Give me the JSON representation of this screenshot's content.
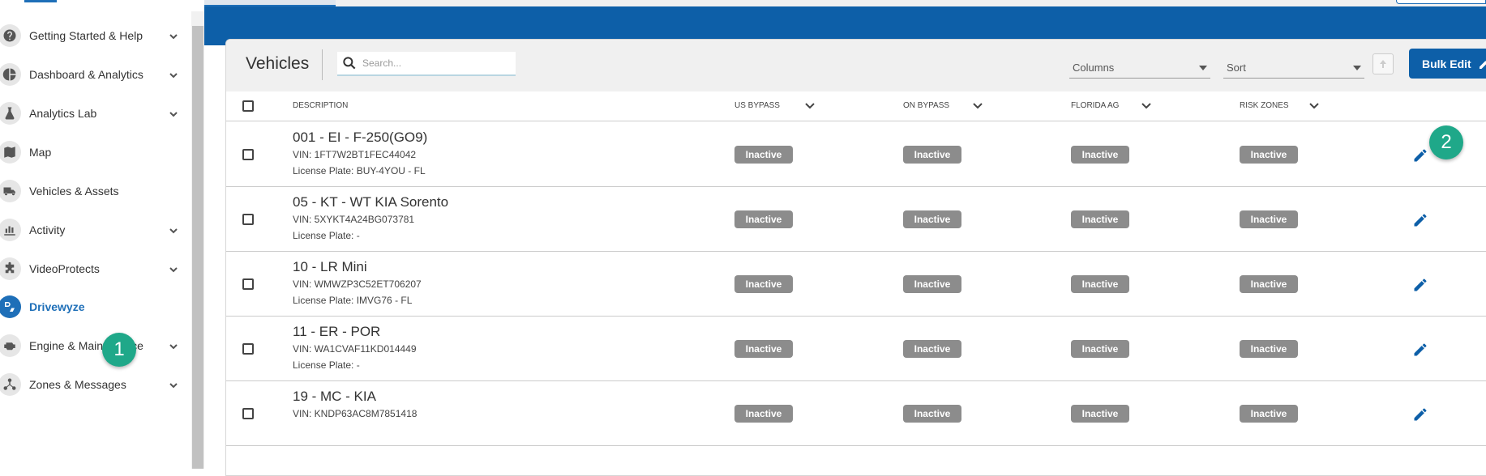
{
  "sidebar": {
    "items": [
      {
        "label": "Getting Started & Help",
        "icon": "question-circle-icon",
        "has_chevron": true
      },
      {
        "label": "Dashboard & Analytics",
        "icon": "pie-chart-icon",
        "has_chevron": true
      },
      {
        "label": "Analytics Lab",
        "icon": "flask-icon",
        "has_chevron": true
      },
      {
        "label": "Map",
        "icon": "map-icon",
        "has_chevron": false
      },
      {
        "label": "Vehicles & Assets",
        "icon": "truck-icon",
        "has_chevron": false
      },
      {
        "label": "Activity",
        "icon": "bar-chart-icon",
        "has_chevron": true
      },
      {
        "label": "VideoProtects",
        "icon": "puzzle-icon",
        "has_chevron": true
      },
      {
        "label": "Drivewyze",
        "icon": "drivewyze-icon",
        "has_chevron": false,
        "active": true
      },
      {
        "label": "Engine & Maintenance",
        "icon": "engine-icon",
        "has_chevron": true
      },
      {
        "label": "Zones & Messages",
        "icon": "network-icon",
        "has_chevron": true
      }
    ]
  },
  "callouts": {
    "one": "1",
    "two": "2"
  },
  "page": {
    "title": "Vehicles",
    "search_placeholder": "Search...",
    "columns_label": "Columns",
    "sort_label": "Sort",
    "bulk_edit_label": "Bulk Edit"
  },
  "table": {
    "headers": [
      "DESCRIPTION",
      "US BYPASS",
      "ON BYPASS",
      "FLORIDA AG",
      "RISK ZONES"
    ],
    "rows": [
      {
        "title": "001 - EI - F-250(GO9)",
        "vin": "VIN: 1FT7W2BT1FEC44042",
        "plate": "License Plate: BUY-4YOU - FL",
        "status": [
          "Inactive",
          "Inactive",
          "Inactive",
          "Inactive"
        ]
      },
      {
        "title": "05 - KT - WT KIA Sorento",
        "vin": "VIN: 5XYKT4A24BG073781",
        "plate": "License Plate: -",
        "status": [
          "Inactive",
          "Inactive",
          "Inactive",
          "Inactive"
        ]
      },
      {
        "title": "10 - LR Mini",
        "vin": "VIN: WMWZP3C52ET706207",
        "plate": "License Plate: IMVG76 - FL",
        "status": [
          "Inactive",
          "Inactive",
          "Inactive",
          "Inactive"
        ]
      },
      {
        "title": "11 - ER - POR",
        "vin": "VIN: WA1CVAF11KD014449",
        "plate": "License Plate: -",
        "status": [
          "Inactive",
          "Inactive",
          "Inactive",
          "Inactive"
        ]
      },
      {
        "title": "19 - MC - KIA",
        "vin": "VIN: KNDP63AC8M7851418",
        "plate": "",
        "status": [
          "Inactive",
          "Inactive",
          "Inactive",
          "Inactive"
        ]
      }
    ]
  },
  "colors": {
    "brand_blue": "#0d5fa8",
    "callout_green": "#1fa889",
    "inactive_gray": "#8c8c8c"
  }
}
